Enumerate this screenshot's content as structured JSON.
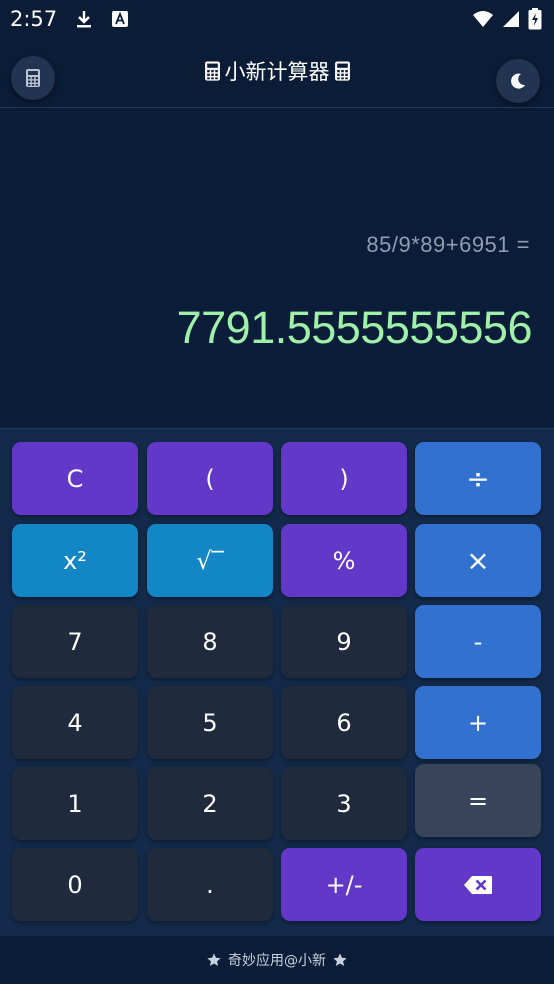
{
  "status_bar": {
    "time": "2:57",
    "icons": [
      "download-icon",
      "font-icon",
      "wifi-icon",
      "signal-icon",
      "battery-charging-icon"
    ]
  },
  "header": {
    "title": "小新计算器",
    "left_button_icon": "calculator-icon",
    "right_button_icon": "moon-icon"
  },
  "display": {
    "expression": "85/9*89+6951 =",
    "result": "7791.5555555556"
  },
  "keypad": {
    "rows": [
      [
        {
          "label": "C",
          "style": "purple"
        },
        {
          "label": "(",
          "style": "purple"
        },
        {
          "label": ")",
          "style": "purple"
        },
        {
          "label": "÷",
          "style": "blue"
        }
      ],
      [
        {
          "label": "x²",
          "style": "cyan"
        },
        {
          "label": "√‾",
          "style": "cyan"
        },
        {
          "label": "%",
          "style": "purple"
        },
        {
          "label": "×",
          "style": "blue"
        }
      ],
      [
        {
          "label": "7",
          "style": "dark"
        },
        {
          "label": "8",
          "style": "dark"
        },
        {
          "label": "9",
          "style": "dark"
        },
        {
          "label": "-",
          "style": "blue"
        }
      ],
      [
        {
          "label": "4",
          "style": "dark"
        },
        {
          "label": "5",
          "style": "dark"
        },
        {
          "label": "6",
          "style": "dark"
        },
        {
          "label": "+",
          "style": "blue"
        }
      ],
      [
        {
          "label": "1",
          "style": "dark"
        },
        {
          "label": "2",
          "style": "dark"
        },
        {
          "label": "3",
          "style": "dark"
        },
        {
          "label": "=",
          "style": "grey"
        }
      ],
      [
        {
          "label": "0",
          "style": "dark"
        },
        {
          "label": ".",
          "style": "dark"
        },
        {
          "label": "+/-",
          "style": "purple"
        },
        {
          "label": "",
          "style": "purple",
          "icon": "backspace-icon"
        }
      ]
    ]
  },
  "footer": {
    "text": "奇妙应用@小新",
    "icon": "star-icon"
  },
  "colors": {
    "purple": "#6338c9",
    "blue": "#3371d1",
    "cyan": "#1387c6",
    "dark": "#1f2a3c",
    "grey": "#374459",
    "result_green": "#9ff0a8"
  }
}
